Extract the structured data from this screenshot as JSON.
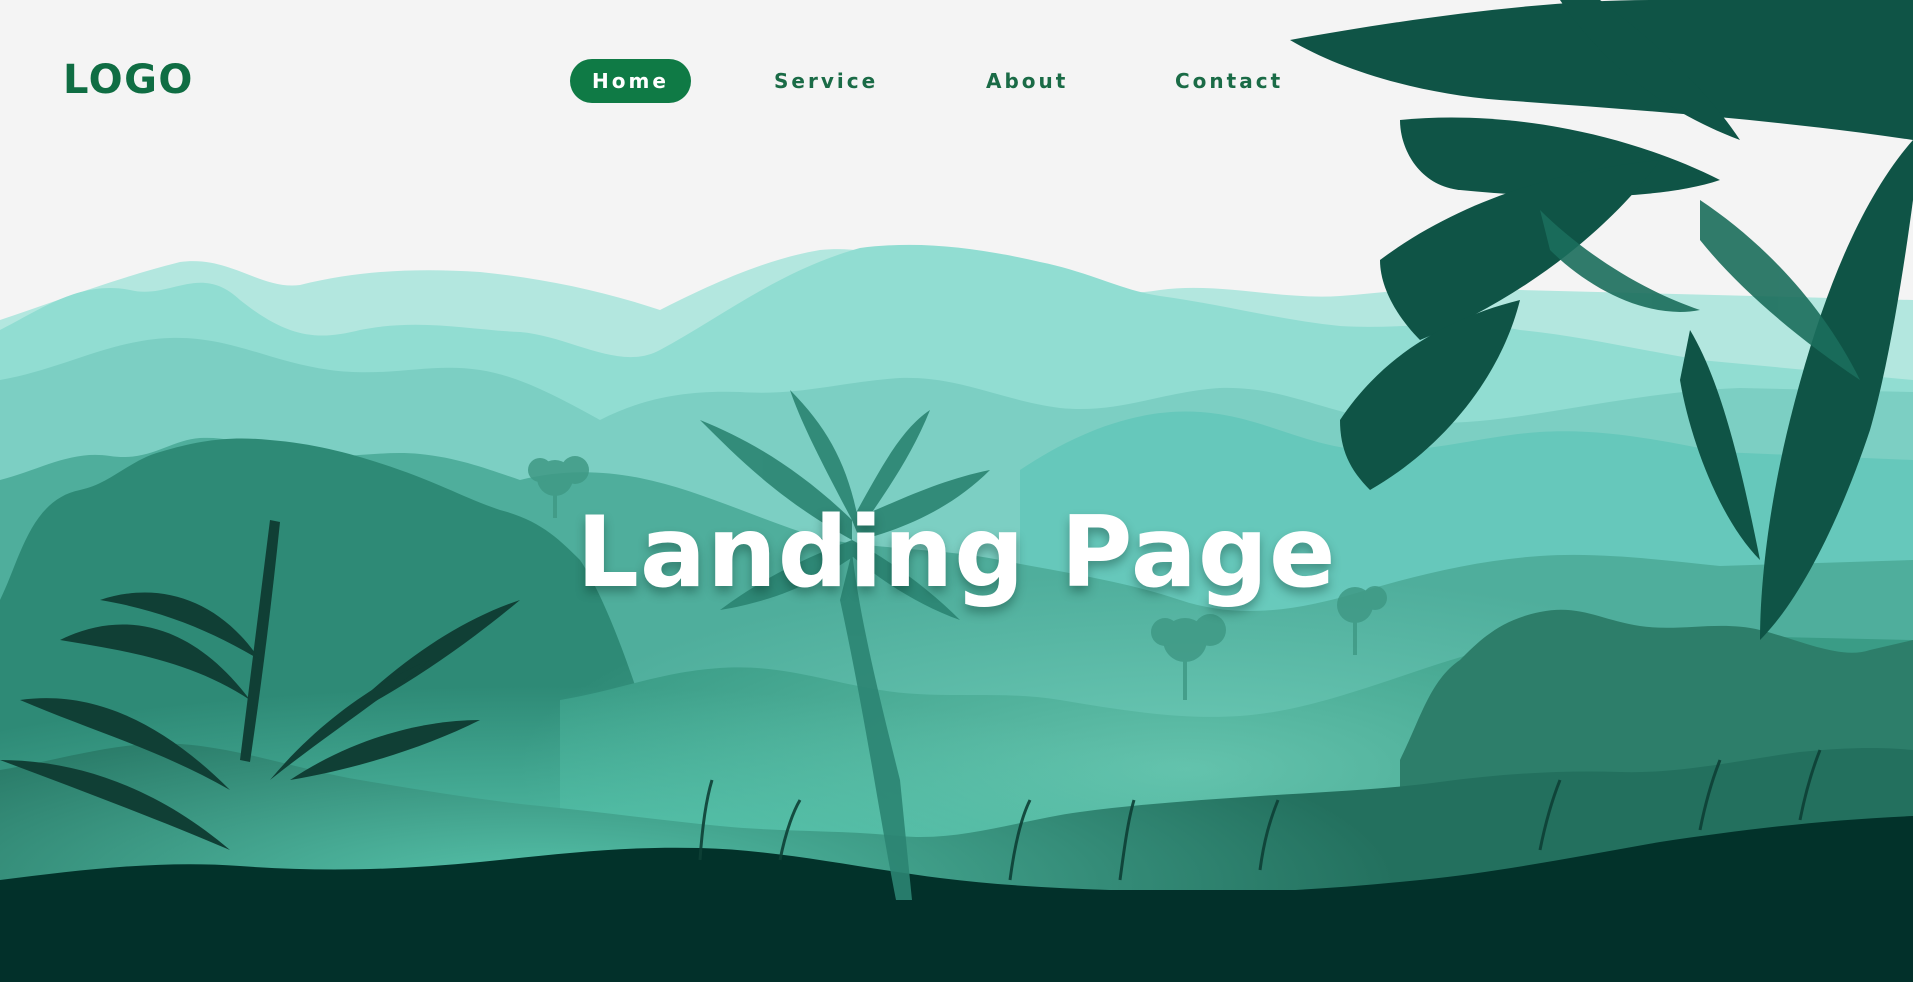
{
  "header": {
    "logo": "LOGO",
    "nav": [
      {
        "label": "Home",
        "active": true
      },
      {
        "label": "Service",
        "active": false
      },
      {
        "label": "About",
        "active": false
      },
      {
        "label": "Contact",
        "active": false
      }
    ]
  },
  "hero": {
    "title": "Landing Page"
  },
  "colors": {
    "brand": "#0f7a45",
    "background": "#f4f4f4",
    "ground": "#022f27"
  }
}
